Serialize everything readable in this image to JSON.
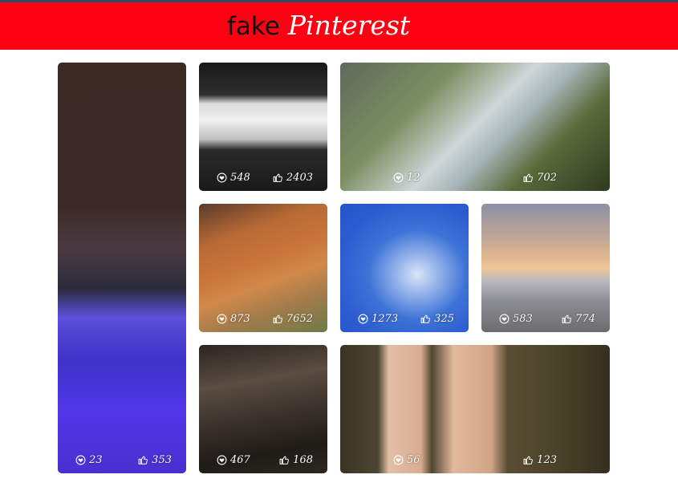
{
  "header": {
    "logo_fake": "fake",
    "logo_pinterest": "Pinterest",
    "bg_color": "#ff0012"
  },
  "icons": {
    "heart": "heart-circle-icon",
    "like": "thumbs-up-icon"
  },
  "tiles": [
    {
      "id": "t1",
      "hearts": "23",
      "likes": "353"
    },
    {
      "id": "t2",
      "hearts": "548",
      "likes": "2403"
    },
    {
      "id": "t3",
      "hearts": "12",
      "likes": "702"
    },
    {
      "id": "t4",
      "hearts": "873",
      "likes": "7652"
    },
    {
      "id": "t5",
      "hearts": "1273",
      "likes": "325"
    },
    {
      "id": "t6",
      "hearts": "583",
      "likes": "774"
    },
    {
      "id": "t7",
      "hearts": "467",
      "likes": "168"
    },
    {
      "id": "t8",
      "hearts": "56",
      "likes": "123"
    }
  ]
}
